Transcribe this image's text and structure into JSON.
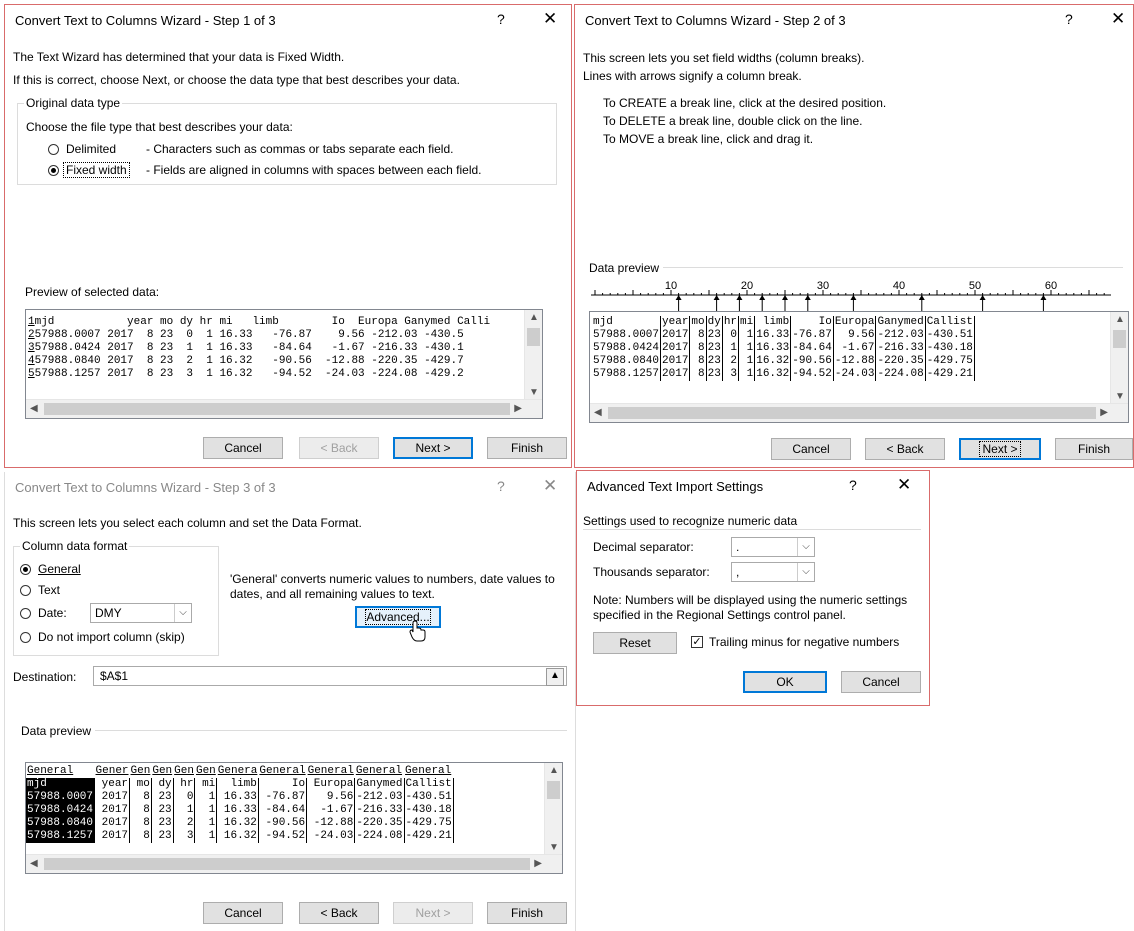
{
  "step1": {
    "title": "Convert Text to Columns Wizard - Step 1 of 3",
    "help": "?",
    "close": "✕",
    "line1": "The Text Wizard has determined that your data is Fixed Width.",
    "line2": "If this is correct, choose Next, or choose the data type that best describes your data.",
    "group_label": "Original data type",
    "choose_label": "Choose the file type that best describes your data:",
    "opt_delimited": "Delimited",
    "opt_delimited_desc": "- Characters such as commas or tabs separate each field.",
    "opt_fixed": "Fixed width",
    "opt_fixed_desc": "- Fields are aligned in columns with spaces between each field.",
    "preview_label": "Preview of selected data:",
    "preview_lines": [
      {
        "n": "1",
        "text": "mjd           year mo dy hr mi   limb        Io  Europa Ganymed Calli"
      },
      {
        "n": "2",
        "text": "57988.0007 2017  8 23  0  1 16.33   -76.87    9.56 -212.03 -430.5"
      },
      {
        "n": "3",
        "text": "57988.0424 2017  8 23  1  1 16.33   -84.64   -1.67 -216.33 -430.1"
      },
      {
        "n": "4",
        "text": "57988.0840 2017  8 23  2  1 16.32   -90.56  -12.88 -220.35 -429.7"
      },
      {
        "n": "5",
        "text": "57988.1257 2017  8 23  3  1 16.32   -94.52  -24.03 -224.08 -429.2"
      }
    ],
    "btn_cancel": "Cancel",
    "btn_back": "< Back",
    "btn_next": "Next >",
    "btn_finish": "Finish"
  },
  "step2": {
    "title": "Convert Text to Columns Wizard - Step 2 of 3",
    "help": "?",
    "close": "✕",
    "line1": "This screen lets you set field widths (column breaks).",
    "line2": "Lines with arrows signify a column break.",
    "instr1": "To CREATE a break line, click at the desired position.",
    "instr2": "To DELETE a break line, double click on the line.",
    "instr3": "To MOVE a break line, click and drag it.",
    "preview_label": "Data preview",
    "ruler": [
      "10",
      "20",
      "30",
      "40",
      "50",
      "60"
    ],
    "header": [
      "mjd",
      "year",
      "mo",
      "dy",
      "hr",
      "mi",
      "limb",
      "Io",
      "Europa",
      "Ganymed",
      "Callist"
    ],
    "rows": [
      [
        "57988.0007",
        "2017",
        "8",
        "23",
        "0",
        "1",
        "16.33",
        "-76.87",
        "9.56",
        "-212.03",
        "-430.51"
      ],
      [
        "57988.0424",
        "2017",
        "8",
        "23",
        "1",
        "1",
        "16.33",
        "-84.64",
        "-1.67",
        "-216.33",
        "-430.18"
      ],
      [
        "57988.0840",
        "2017",
        "8",
        "23",
        "2",
        "1",
        "16.32",
        "-90.56",
        "-12.88",
        "-220.35",
        "-429.75"
      ],
      [
        "57988.1257",
        "2017",
        "8",
        "23",
        "3",
        "1",
        "16.32",
        "-94.52",
        "-24.03",
        "-224.08",
        "-429.21"
      ]
    ],
    "btn_cancel": "Cancel",
    "btn_back": "< Back",
    "btn_next": "Next >",
    "btn_finish": "Finish"
  },
  "step3": {
    "title": "Convert Text to Columns Wizard - Step 3 of 3",
    "help": "?",
    "close": "✕",
    "line1": "This screen lets you select each column and set the Data Format.",
    "group_label": "Column data format",
    "opt_general": "General",
    "opt_text": "Text",
    "opt_date": "Date:",
    "date_value": "DMY",
    "opt_skip": "Do not import column (skip)",
    "general_note": "'General' converts numeric values to numbers, date values to dates, and all remaining values to text.",
    "btn_advanced": "Advanced...",
    "dest_label": "Destination:",
    "dest_value": "$A$1",
    "preview_label": "Data preview",
    "format_row": [
      "General",
      "Gener",
      "Gen",
      "Gen",
      "Gen",
      "Gen",
      "Genera",
      "General",
      "General",
      "General",
      "General"
    ],
    "header": [
      "mjd",
      "year",
      "mo",
      "dy",
      "hr",
      "mi",
      "limb",
      "Io",
      "Europa",
      "Ganymed",
      "Callist"
    ],
    "rows": [
      [
        "57988.0007",
        "2017",
        "8",
        "23",
        "0",
        "1",
        "16.33",
        "-76.87",
        "9.56",
        "-212.03",
        "-430.51"
      ],
      [
        "57988.0424",
        "2017",
        "8",
        "23",
        "1",
        "1",
        "16.33",
        "-84.64",
        "-1.67",
        "-216.33",
        "-430.18"
      ],
      [
        "57988.0840",
        "2017",
        "8",
        "23",
        "2",
        "1",
        "16.32",
        "-90.56",
        "-12.88",
        "-220.35",
        "-429.75"
      ],
      [
        "57988.1257",
        "2017",
        "8",
        "23",
        "3",
        "1",
        "16.32",
        "-94.52",
        "-24.03",
        "-224.08",
        "-429.21"
      ]
    ],
    "btn_cancel": "Cancel",
    "btn_back": "< Back",
    "btn_next": "Next >",
    "btn_finish": "Finish"
  },
  "advanced": {
    "title": "Advanced Text Import Settings",
    "help": "?",
    "close": "✕",
    "section": "Settings used to recognize numeric data",
    "decimal_label": "Decimal separator:",
    "decimal_value": ".",
    "thousands_label": "Thousands separator:",
    "thousands_value": ",",
    "note": "Note: Numbers will be displayed using the numeric settings specified in the Regional Settings control panel.",
    "btn_reset": "Reset",
    "trailing_label": "Trailing minus for negative numbers",
    "btn_ok": "OK",
    "btn_cancel": "Cancel"
  }
}
